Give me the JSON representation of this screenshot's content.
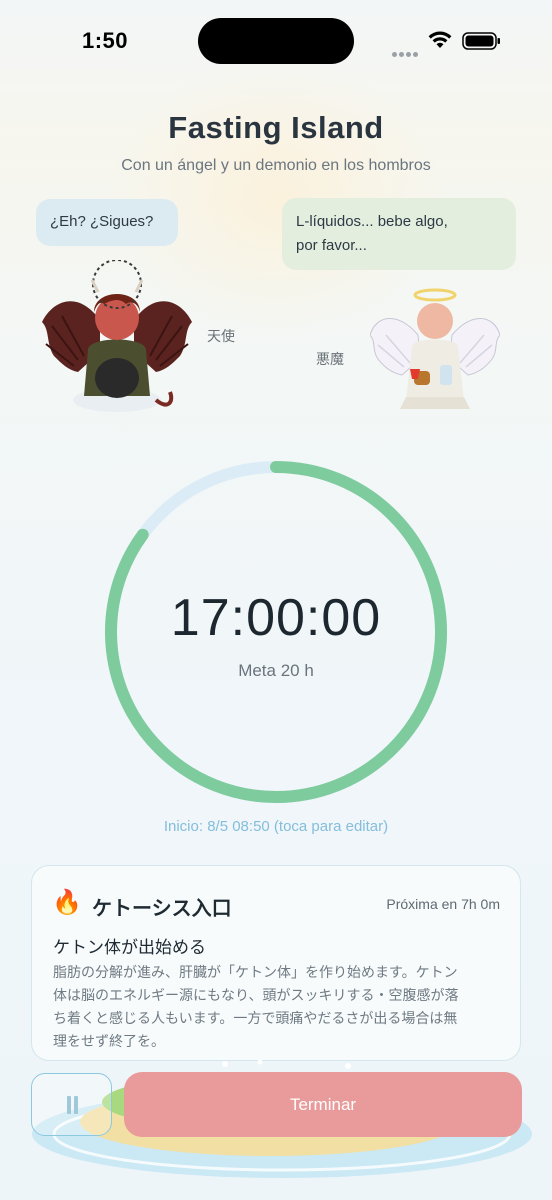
{
  "status_bar": {
    "time": "1:50"
  },
  "header": {
    "title": "Fasting Island",
    "subtitle": "Con un ángel y un demonio en los hombros"
  },
  "characters": {
    "left": {
      "speech": "¿Eh? ¿Sigues?",
      "label": "天使"
    },
    "right": {
      "speech_lines": [
        "L-líquidos... bebe algo,",
        "por favor..."
      ],
      "label": "悪魔"
    }
  },
  "timer": {
    "elapsed": "17:00:00",
    "goal": "Meta 20 h",
    "progress_fraction": 0.85,
    "start_text": "Inicio: 8/5 08:50 (toca para editar)"
  },
  "phase_card": {
    "icon": "fire-icon",
    "title": "ケトーシス入口",
    "next": "Próxima en 7h 0m",
    "subtitle": "ケトン体が出始める",
    "description_lines": [
      "脂肪の分解が進み、肝臓が「ケトン体」を作り始めます。ケトン",
      "体は脳のエネルギー源にもなり、頭がスッキリする・空腹感が落",
      "ち着くと感じる人もいます。一方で頭痛やだるさが出る場合は無",
      "理をせず終了を。"
    ]
  },
  "actions": {
    "pause_icon": "pause-icon",
    "end_label": "Terminar"
  },
  "colors": {
    "ring_progress": "#7ecb9e",
    "ring_track": "#dcecf6",
    "end_button": "#e89b9a",
    "start_link": "#84bedb"
  }
}
